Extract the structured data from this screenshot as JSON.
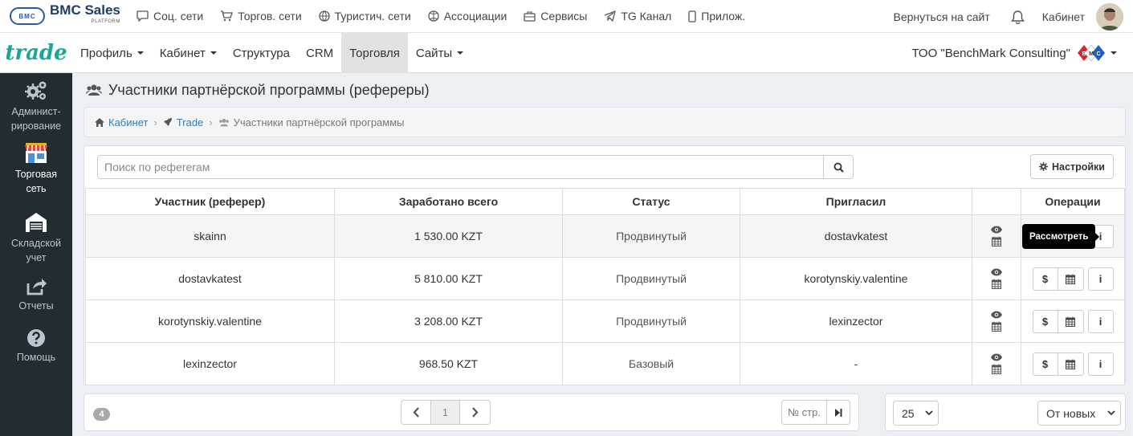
{
  "topbar": {
    "logo_badge": "BMC",
    "logo_text": "BMC Sales",
    "logo_sub": "PLATFORM",
    "nav": [
      {
        "label": "Соц. сети",
        "icon": "chat-bubble-icon"
      },
      {
        "label": "Торгов. сети",
        "icon": "cart-icon"
      },
      {
        "label": "Туристич. сети",
        "icon": "globe-icon"
      },
      {
        "label": "Ассоциации",
        "icon": "basketball-icon"
      },
      {
        "label": "Сервисы",
        "icon": "briefcase-icon"
      },
      {
        "label": "TG Канал",
        "icon": "telegram-icon"
      },
      {
        "label": "Прилож.",
        "icon": "phone-icon"
      }
    ],
    "back_label": "Вернуться на сайт",
    "cabinet_label": "Кабинет"
  },
  "navbar": {
    "brand": "trade",
    "menu": [
      {
        "label": "Профиль",
        "dropdown": true,
        "active": false
      },
      {
        "label": "Кабинет",
        "dropdown": true,
        "active": false
      },
      {
        "label": "Структура",
        "dropdown": false,
        "active": false
      },
      {
        "label": "CRM",
        "dropdown": false,
        "active": false
      },
      {
        "label": "Торговля",
        "dropdown": false,
        "active": true
      },
      {
        "label": "Сайты",
        "dropdown": true,
        "active": false
      }
    ],
    "company": "ТОО \"BenchMark Consulting\""
  },
  "sidebar": {
    "items": [
      {
        "label1": "Админист-",
        "label2": "рирование",
        "icon": "gears-icon",
        "active": false
      },
      {
        "label1": "Торговая",
        "label2": "сеть",
        "icon": "store-icon",
        "active": true
      },
      {
        "label1": "Складской",
        "label2": "учет",
        "icon": "warehouse-icon",
        "active": false
      },
      {
        "label1": "Отчеты",
        "label2": "",
        "icon": "share-icon",
        "active": false
      },
      {
        "label1": "Помощь",
        "label2": "",
        "icon": "question-icon",
        "active": false
      }
    ]
  },
  "page": {
    "title": "Участники партнёрской программы (рефереры)",
    "breadcrumb": [
      "Кабинет",
      "Trade",
      "Участники партнёрской программы"
    ]
  },
  "search": {
    "placeholder": "Поиск по рефererам"
  },
  "settings_label": "Настройки",
  "table": {
    "headers": [
      "Участник (реферер)",
      "Заработано всего",
      "Статус",
      "Пригласил",
      "",
      "Операции"
    ],
    "rows": [
      {
        "participant": "skainn",
        "earned": "1 530.00 KZT",
        "status": "Продвинутый",
        "invited_by": "dostavkatest"
      },
      {
        "participant": "dostavkatest",
        "earned": "5 810.00 KZT",
        "status": "Продвинутый",
        "invited_by": "korotynskiy.valentine"
      },
      {
        "participant": "korotynskiy.valentine",
        "earned": "3 208.00 KZT",
        "status": "Продвинутый",
        "invited_by": "lexinzector"
      },
      {
        "participant": "lexinzector",
        "earned": "968.50 KZT",
        "status": "Базовый",
        "invited_by": "-"
      }
    ],
    "tooltip": "Рассмотреть",
    "op_dollar": "$",
    "op_info": "i"
  },
  "footer": {
    "total_count": "4",
    "current_page": "1",
    "page_input_placeholder": "№ стр.",
    "per_page": "25",
    "sort": "От новых"
  },
  "colors": {
    "brand": "#1aa79a",
    "sidebar_bg": "#222d32",
    "link": "#337ab7",
    "active_tab": "#e2e2e2"
  }
}
